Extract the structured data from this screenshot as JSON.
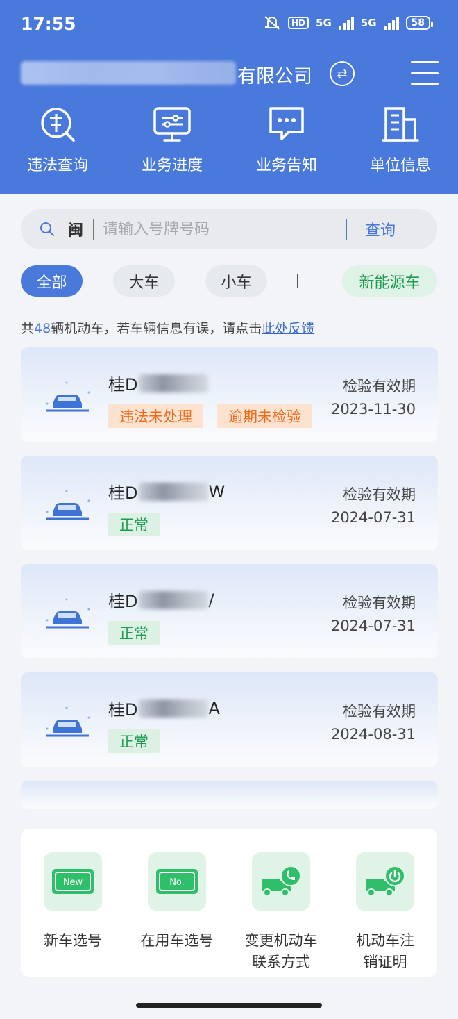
{
  "status_bar": {
    "time": "17:55",
    "battery": "58",
    "hd": "HD",
    "network_1": "5G",
    "network_2": "5G"
  },
  "header": {
    "company_suffix": "有限公司",
    "swap_icon": "swap-icon",
    "menu_icon": "menu-icon"
  },
  "quick_actions": [
    {
      "label": "违法查询",
      "icon": "violation-query-icon"
    },
    {
      "label": "业务进度",
      "icon": "monitor-progress-icon"
    },
    {
      "label": "业务告知",
      "icon": "message-icon"
    },
    {
      "label": "单位信息",
      "icon": "building-icon"
    }
  ],
  "search": {
    "province": "闽",
    "placeholder": "请输入号牌号码",
    "button": "查询"
  },
  "filters": [
    {
      "label": "全部",
      "active": true
    },
    {
      "label": "大车",
      "active": false
    },
    {
      "label": "小车",
      "active": false
    },
    {
      "label": "新能源车",
      "active": false
    }
  ],
  "notice": {
    "prefix": "共",
    "count": "48",
    "middle": "辆机动车，若车辆信息有误，请点击",
    "link": "此处反馈"
  },
  "vehicles": [
    {
      "plate_prefix": "桂D",
      "plate_suffix": "",
      "tags": [
        "违法未处理",
        "逾期未检验"
      ],
      "expiry_label": "检验有效期",
      "expiry_date": "2023-11-30"
    },
    {
      "plate_prefix": "桂D",
      "plate_suffix": "W",
      "tags": [
        "正常"
      ],
      "expiry_label": "检验有效期",
      "expiry_date": "2024-07-31"
    },
    {
      "plate_prefix": "桂D",
      "plate_suffix": "/",
      "tags": [
        "正常"
      ],
      "expiry_label": "检验有效期",
      "expiry_date": "2024-07-31"
    },
    {
      "plate_prefix": "桂D",
      "plate_suffix": "A",
      "tags": [
        "正常"
      ],
      "expiry_label": "检验有效期",
      "expiry_date": "2024-08-31"
    }
  ],
  "services": [
    {
      "label_line1": "新车选号",
      "label_line2": "",
      "icon": "new-plate-icon",
      "icon_text": "New"
    },
    {
      "label_line1": "在用车选号",
      "label_line2": "",
      "icon": "plate-number-icon",
      "icon_text": "No."
    },
    {
      "label_line1": "变更机动车",
      "label_line2": "联系方式",
      "icon": "truck-phone-icon",
      "icon_text": ""
    },
    {
      "label_line1": "机动车注",
      "label_line2": "销证明",
      "icon": "truck-cancel-icon",
      "icon_text": ""
    }
  ],
  "colors": {
    "brand": "#4a79dc",
    "warning": "#ee6b1e",
    "success": "#1f9a52"
  }
}
